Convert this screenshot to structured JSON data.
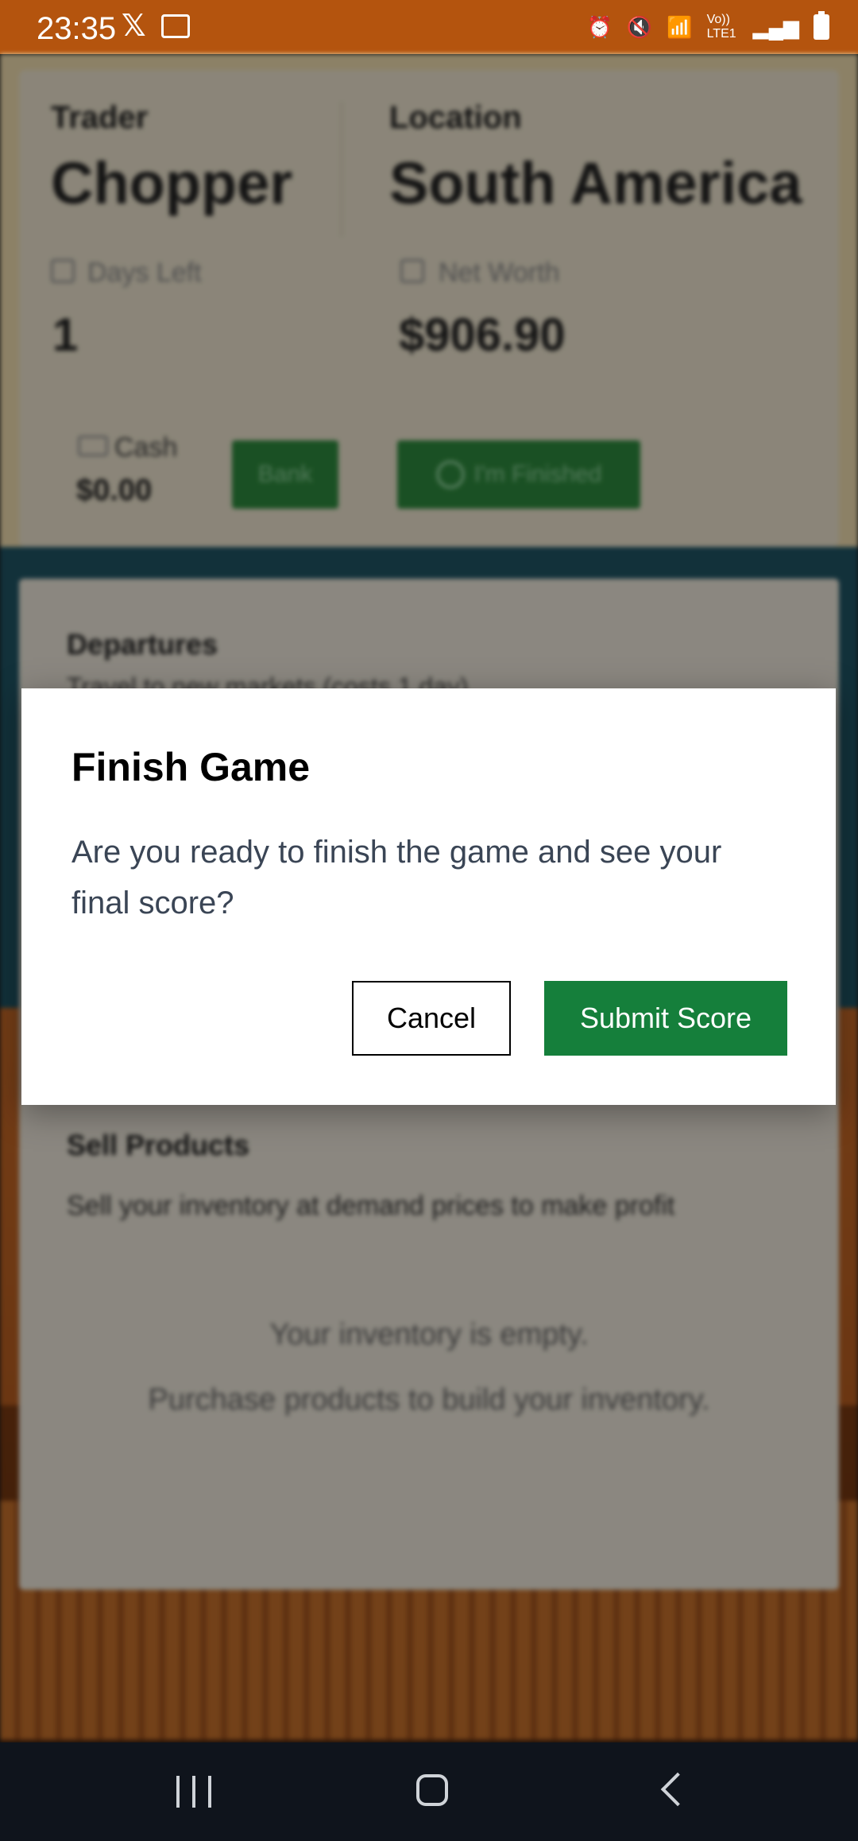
{
  "status_bar": {
    "time": "23:35",
    "icons": [
      "x-icon",
      "voicemail-icon",
      "alarm-icon",
      "mute-icon",
      "wifi-icon",
      "volte-icon",
      "signal-icon",
      "battery-icon"
    ],
    "network_label": "Vo)) LTE1",
    "background_color": "#b4540e"
  },
  "game": {
    "trader_label": "Trader",
    "trader_name": "Chopper",
    "location_label": "Location",
    "location_name": "South America",
    "days_left_label": "Days Left",
    "days_left": "1",
    "net_worth_label": "Net Worth",
    "net_worth": "$906.90",
    "cash_label": "Cash",
    "cash": "$0.00",
    "bank_button": "Bank",
    "finished_button": "I'm Finished",
    "departures_title": "Departures",
    "departures_subtitle": "Travel to new markets (costs 1 day)",
    "sell_title": "Sell Products",
    "sell_subtitle": "Sell your inventory at demand prices to make profit",
    "empty_line1": "Your inventory is empty.",
    "empty_line2": "Purchase products to build your inventory."
  },
  "dialog": {
    "title": "Finish Game",
    "message": "Are you ready to finish the game and see your final score?",
    "cancel_label": "Cancel",
    "submit_label": "Submit Score",
    "submit_color": "#157f3b"
  },
  "nav_bar": {
    "icons": [
      "recent-apps-icon",
      "home-icon",
      "back-icon"
    ]
  }
}
